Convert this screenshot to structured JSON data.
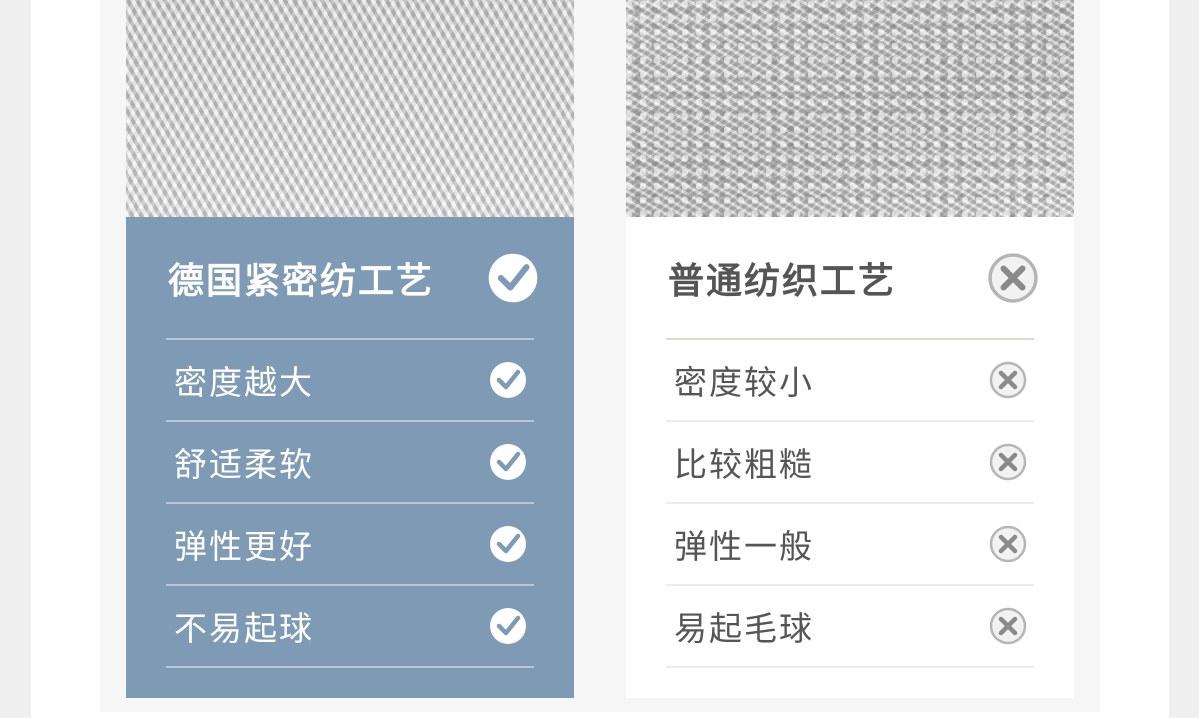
{
  "comparison": {
    "good": {
      "title": "德国紧密纺工艺",
      "title_icon": "check-circle-icon",
      "items": [
        {
          "label": "密度越大",
          "icon": "check-circle-icon"
        },
        {
          "label": "舒适柔软",
          "icon": "check-circle-icon"
        },
        {
          "label": "弹性更好",
          "icon": "check-circle-icon"
        },
        {
          "label": "不易起球",
          "icon": "check-circle-icon"
        }
      ],
      "accent": "#7f9ab4"
    },
    "bad": {
      "title": "普通纺织工艺",
      "title_icon": "cross-circle-icon",
      "items": [
        {
          "label": "密度较小",
          "icon": "cross-circle-icon"
        },
        {
          "label": "比较粗糙",
          "icon": "cross-circle-icon"
        },
        {
          "label": "弹性一般",
          "icon": "cross-circle-icon"
        },
        {
          "label": "易起毛球",
          "icon": "cross-circle-icon"
        }
      ],
      "accent": "#ffffff"
    }
  }
}
